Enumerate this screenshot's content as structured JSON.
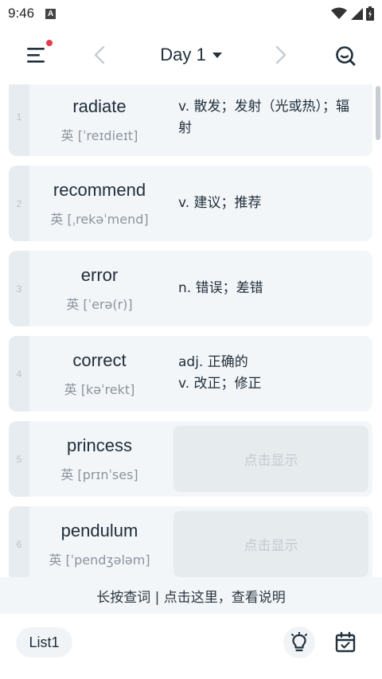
{
  "status_bar": {
    "time": "9:46",
    "app_icon_letter": "A"
  },
  "header": {
    "title": "Day 1"
  },
  "words": [
    {
      "index": "1",
      "word": "radiate",
      "phonetic": "英 [ˈreɪdieɪt]",
      "definition": "v. 散发；发射（光或热）；辐射",
      "revealed": true
    },
    {
      "index": "2",
      "word": "recommend",
      "phonetic": "英 [ˌrekəˈmend]",
      "definition": "v. 建议；推荐",
      "revealed": true
    },
    {
      "index": "3",
      "word": "error",
      "phonetic": "英 [ˈerə(r)]",
      "definition": "n. 错误；差错",
      "revealed": true
    },
    {
      "index": "4",
      "word": "correct",
      "phonetic": "英 [kəˈrekt]",
      "definition_line1": "adj. 正确的",
      "definition_line2": "v. 改正；修正",
      "revealed": true
    },
    {
      "index": "5",
      "word": "princess",
      "phonetic": "英 [prɪnˈses]",
      "reveal_label": "点击显示",
      "revealed": false
    },
    {
      "index": "6",
      "word": "pendulum",
      "phonetic": "英 [ˈpendʒələm]",
      "reveal_label": "点击显示",
      "revealed": false
    }
  ],
  "hint": "长按查词 | 点击这里，查看说明",
  "footer": {
    "list_label": "List1"
  },
  "icons": {
    "menu": "menu-icon",
    "prev": "chevron-left-icon",
    "next": "chevron-right-icon",
    "search": "search-icon",
    "bulb": "lightbulb-icon",
    "calendar": "calendar-check-icon",
    "wifi": "wifi-icon",
    "signal": "signal-icon",
    "battery": "battery-icon"
  },
  "colors": {
    "accent_dot": "#e83a4f",
    "card_bg": "#f3f6f9",
    "index_bg": "#e6ecf0"
  }
}
